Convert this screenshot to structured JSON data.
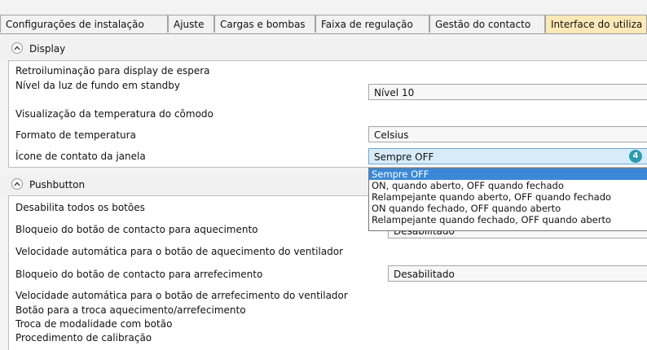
{
  "tabs": [
    {
      "label": "Configurações de instalação"
    },
    {
      "label": "Ajuste"
    },
    {
      "label": "Cargas e bombas"
    },
    {
      "label": "Faixa de regulação"
    },
    {
      "label": "Gestão do contacto"
    },
    {
      "label": "Interface do utiliza"
    }
  ],
  "display": {
    "title": "Display",
    "rows": [
      {
        "label": "Retroiluminação para display de espera"
      },
      {
        "label": "Nível da luz de fundo em standby",
        "value": "Nível 10"
      },
      {
        "label": "Visualização da temperatura do cômodo"
      },
      {
        "label": "Formato de temperatura",
        "value": "Celsius"
      },
      {
        "label": "Ícone de contato da janela",
        "value": "Sempre OFF",
        "badge": "4"
      }
    ],
    "dropdown_options": [
      "Sempre OFF",
      "ON, quando aberto, OFF quando fechado",
      "Relampejante quando aberto, OFF quando fechado",
      "ON quando fechado, OFF quando aberto",
      "Relampejante quando fechado, OFF quando aberto"
    ],
    "dropdown_selected": 0
  },
  "pushbutton": {
    "title": "Pushbutton",
    "rows": [
      {
        "label": "Desabilita todos os botões"
      },
      {
        "label": "Bloqueio do botão de contacto para aquecimento",
        "value": "Desabilitado"
      },
      {
        "label": "Velocidade automática para o botão de aquecimento do ventilador"
      },
      {
        "label": "Bloqueio do botão de contacto para arrefecimento",
        "value": "Desabilitado"
      },
      {
        "label": "Velocidade automática para o botão de arrefecimento do ventilador"
      },
      {
        "label": "Botão para a troca aquecimento/arrefecimento"
      },
      {
        "label": "Troca de modalidade com botão"
      },
      {
        "label": "Procedimento de calibração"
      }
    ]
  },
  "colors": {
    "active_tab": "#fde9b8",
    "selected_field": "#d7ebf8",
    "badge": "#2a9bb0",
    "dropdown_highlight": "#3b88d6"
  }
}
